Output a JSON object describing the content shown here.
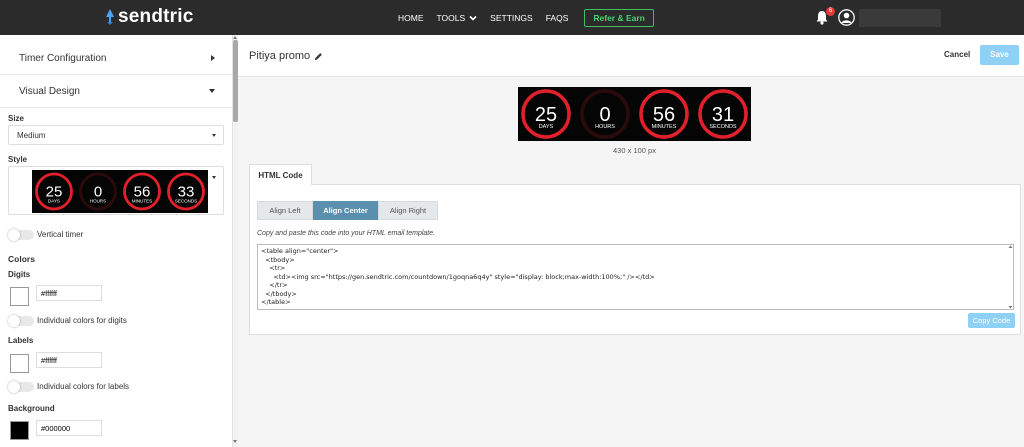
{
  "brand": {
    "name": "sendtric"
  },
  "nav": {
    "items": [
      "HOME",
      "TOOLS",
      "SETTINGS",
      "FAQS"
    ],
    "refer_label": "Refer & Earn",
    "notification_count": "6"
  },
  "sidebar": {
    "sections": {
      "timer_configuration": "Timer Configuration",
      "visual_design": "Visual Design"
    },
    "size": {
      "label": "Size",
      "value": "Medium"
    },
    "style": {
      "label": "Style"
    },
    "vertical_timer": {
      "label": "Vertical timer"
    },
    "colors": {
      "title": "Colors",
      "digits": {
        "label": "Digits",
        "hex": "#ffffff",
        "toggle_label": "Individual colors for digits",
        "swatch": "#ffffff"
      },
      "labels": {
        "label": "Labels",
        "hex": "#ffffff",
        "toggle_label": "Individual colors for labels",
        "swatch": "#ffffff"
      },
      "background": {
        "label": "Background",
        "hex": "#000000",
        "swatch": "#000000"
      }
    }
  },
  "header": {
    "title": "Pitiya promo",
    "cancel_label": "Cancel",
    "save_label": "Save"
  },
  "timer": {
    "units": [
      {
        "value": "25",
        "label": "DAYS"
      },
      {
        "value": "0",
        "label": "HOURS"
      },
      {
        "value": "56",
        "label": "MINUTES"
      },
      {
        "value": "31",
        "label": "SECONDS"
      }
    ],
    "dimensions": "430 x 100 px",
    "ring_color": "#e0202a"
  },
  "style_thumb": {
    "units": [
      {
        "value": "25",
        "label": "DAYS"
      },
      {
        "value": "0",
        "label": "HOURS"
      },
      {
        "value": "56",
        "label": "MINUTES"
      },
      {
        "value": "33",
        "label": "SECONDS"
      }
    ]
  },
  "code_panel": {
    "tab_label": "HTML Code",
    "align_left": "Align Left",
    "align_center": "Align Center",
    "align_right": "Align Right",
    "hint": "Copy and paste this code into your HTML email template.",
    "code": "<table align=\"center\">\n  <tbody>\n    <tr>\n      <td><img src=\"https://gen.sendtric.com/countdown/1goqna6q4y\" style=\"display: block;max-width:100%;\" /></td>\n    </tr>\n  </tbody>\n</table>",
    "copy_label": "Copy Code"
  }
}
